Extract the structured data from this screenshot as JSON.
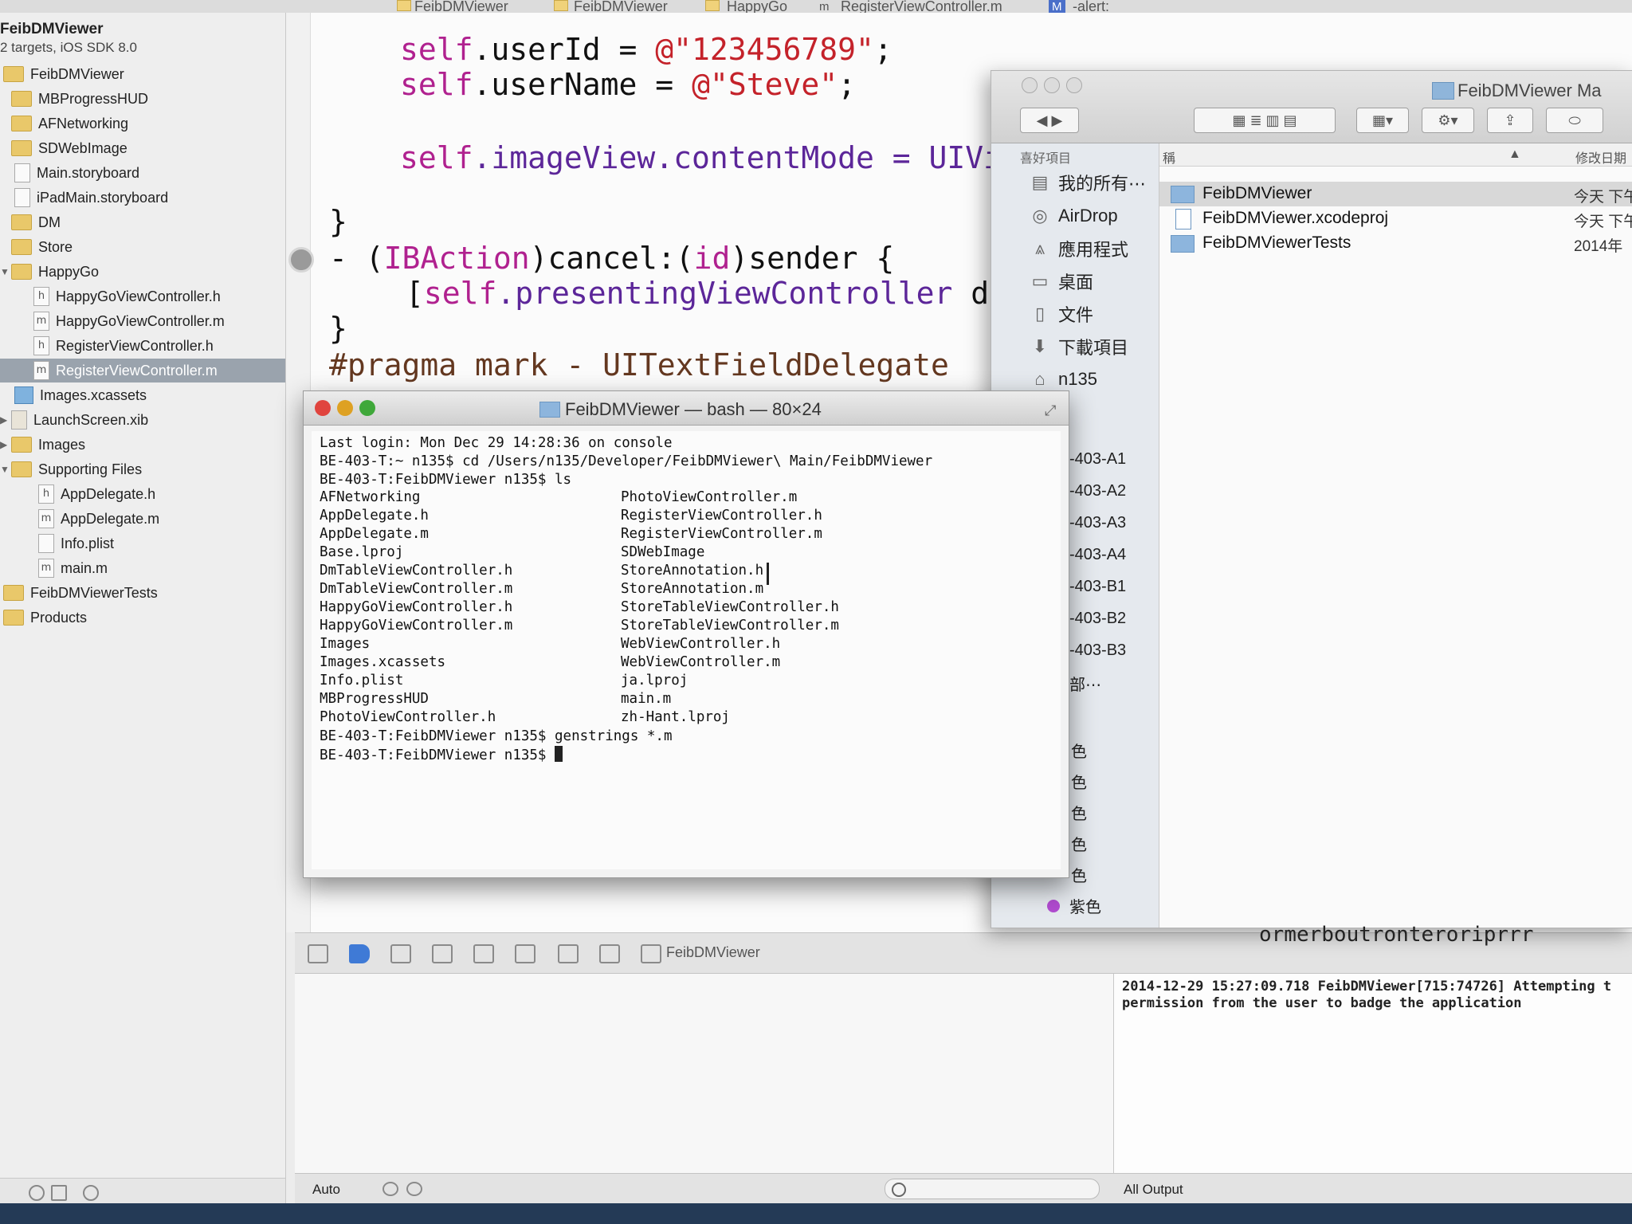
{
  "jumpbar": {
    "crumbs": [
      "FeibDMViewer",
      "FeibDMViewer",
      "HappyGo",
      "RegisterViewController.m",
      "-alert:"
    ],
    "file_badge": "m",
    "method_badge": "M"
  },
  "navigator": {
    "project_name": "FeibDMViewer",
    "project_sub": "2 targets, iOS SDK 8.0",
    "items": [
      {
        "label": "FeibDMViewer",
        "kind": "folder"
      },
      {
        "label": "MBProgressHUD",
        "kind": "folder"
      },
      {
        "label": "AFNetworking",
        "kind": "folder"
      },
      {
        "label": "SDWebImage",
        "kind": "folder"
      },
      {
        "label": "Main.storyboard",
        "kind": "storyboard"
      },
      {
        "label": "iPadMain.storyboard",
        "kind": "storyboard"
      },
      {
        "label": "DM",
        "kind": "folder"
      },
      {
        "label": "Store",
        "kind": "folder"
      },
      {
        "label": "HappyGo",
        "kind": "folder"
      },
      {
        "label": "HappyGoViewController.h",
        "kind": "h"
      },
      {
        "label": "HappyGoViewController.m",
        "kind": "m"
      },
      {
        "label": "RegisterViewController.h",
        "kind": "h"
      },
      {
        "label": "RegisterViewController.m",
        "kind": "m",
        "selected": true
      },
      {
        "label": "Images.xcassets",
        "kind": "asset"
      },
      {
        "label": "LaunchScreen.xib",
        "kind": "xib"
      },
      {
        "label": "Images",
        "kind": "folder"
      },
      {
        "label": "Supporting Files",
        "kind": "folder"
      },
      {
        "label": "AppDelegate.h",
        "kind": "h"
      },
      {
        "label": "AppDelegate.m",
        "kind": "m"
      },
      {
        "label": "Info.plist",
        "kind": "plist"
      },
      {
        "label": "main.m",
        "kind": "m"
      },
      {
        "label": "FeibDMViewerTests",
        "kind": "folder"
      },
      {
        "label": "Products",
        "kind": "folder"
      }
    ],
    "badge_h": "h",
    "badge_m": "m"
  },
  "editor": {
    "l1_a": "self",
    "l1_b": ".userId = ",
    "l1_c": "@\"123456789\"",
    "l1_d": ";",
    "l2_a": "self",
    "l2_b": ".userName = ",
    "l2_c": "@\"Steve\"",
    "l2_d": ";",
    "l3_a": "self",
    "l3_b": ".imageView.contentMode = UIVi",
    "l4": "}",
    "l5_a": "- (",
    "l5_b": "IBAction",
    "l5_c": ")cancel:(",
    "l5_d": "id",
    "l5_e": ")sender {",
    "l6_a": "[",
    "l6_b": "self",
    "l6_c": ".presentingViewController",
    "l6_d": " dis",
    "l7": "}",
    "l8": "#pragma mark - UITextFieldDelegate"
  },
  "debugbar": {
    "target": "FeibDMViewer"
  },
  "console": {
    "log": "2014-12-29 15:27:09.718 FeibDMViewer[715:74726] Attempting t permission from the user to badge the application",
    "left_scope": "Auto",
    "right_scope": "All Output"
  },
  "finder": {
    "title": "FeibDMViewer Ma",
    "favorites_header": "喜好項目",
    "sidebar": [
      {
        "label": "我的所有⋯",
        "icon": "all-files-icon"
      },
      {
        "label": "AirDrop",
        "icon": "airdrop-icon"
      },
      {
        "label": "應用程式",
        "icon": "applications-icon"
      },
      {
        "label": "桌面",
        "icon": "desktop-icon"
      },
      {
        "label": "文件",
        "icon": "documents-icon"
      },
      {
        "label": "下載項目",
        "icon": "downloads-icon"
      },
      {
        "label": "n135",
        "icon": "home-icon"
      }
    ],
    "shared": [
      "-403-A1",
      "-403-A2",
      "-403-A3",
      "-403-A4",
      "-403-B1",
      "-403-B2",
      "-403-B3",
      "部⋯"
    ],
    "tags": [
      "色",
      "色",
      "色",
      "色",
      "色",
      "紫色"
    ],
    "col_name": "稱",
    "col_date": "修改日期",
    "rows": [
      {
        "name": "FeibDMViewer",
        "date": "今天 下午",
        "kind": "folder",
        "selected": true
      },
      {
        "name": "FeibDMViewer.xcodeproj",
        "date": "今天 下午",
        "kind": "doc"
      },
      {
        "name": "FeibDMViewerTests",
        "date": "2014年",
        "kind": "folder"
      }
    ],
    "tail_text": "ormerboutronteroriprrr"
  },
  "terminal": {
    "title": "FeibDMViewer — bash — 80×24",
    "lines": [
      "Last login: Mon Dec 29 14:28:36 on console",
      "BE-403-T:~ n135$ cd /Users/n135/Developer/FeibDMViewer\\ Main/FeibDMViewer",
      "BE-403-T:FeibDMViewer n135$ ls"
    ],
    "ls_left": [
      "AFNetworking",
      "AppDelegate.h",
      "AppDelegate.m",
      "Base.lproj",
      "DmTableViewController.h",
      "DmTableViewController.m",
      "HappyGoViewController.h",
      "HappyGoViewController.m",
      "Images",
      "Images.xcassets",
      "Info.plist",
      "MBProgressHUD",
      "PhotoViewController.h"
    ],
    "ls_right": [
      "PhotoViewController.m",
      "RegisterViewController.h",
      "RegisterViewController.m",
      "SDWebImage",
      "StoreAnnotation.h",
      "StoreAnnotation.m",
      "StoreTableViewController.h",
      "StoreTableViewController.m",
      "WebViewController.h",
      "WebViewController.m",
      "ja.lproj",
      "main.m",
      "zh-Hant.lproj"
    ],
    "cmd_genstrings": "BE-403-T:FeibDMViewer n135$ genstrings *.m",
    "prompt": "BE-403-T:FeibDMViewer n135$ "
  },
  "colors": {
    "keyword": "#b0218f",
    "string": "#c4222a",
    "type": "#5c2699",
    "pragma": "#643820",
    "close": "#e0443e",
    "minimize": "#dea123",
    "zoom": "#3fa83a",
    "tag_purple": "#b14bd0"
  }
}
